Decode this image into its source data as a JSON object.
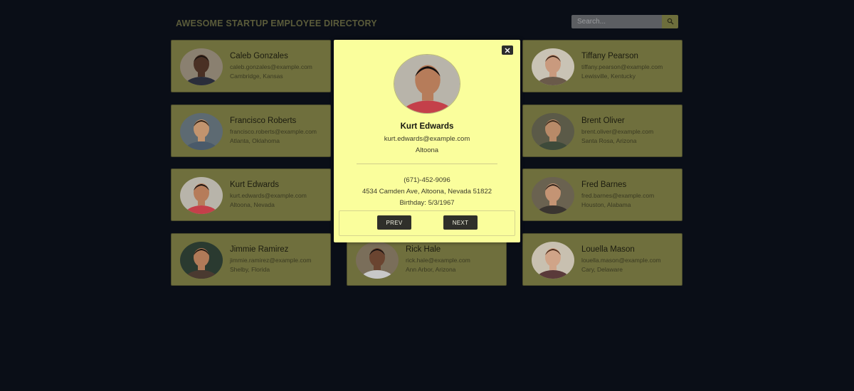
{
  "header": {
    "title": "AWESOME STARTUP EMPLOYEE DIRECTORY",
    "search_placeholder": "Search...",
    "search_icon": "search-icon"
  },
  "employees": [
    {
      "name": "Caleb Gonzales",
      "email": "caleb.gonzales@example.com",
      "location": "Cambridge, Kansas",
      "skin": "#4a3024",
      "hair": "#1a1410",
      "shirt": "#2a2d3a",
      "bg": "#8a8070"
    },
    {
      "name": "Tiffany Pearson",
      "email": "tiffany.pearson@example.com",
      "location": "Lewisville, Kentucky",
      "skin": "#c99a7e",
      "hair": "#3a2418",
      "shirt": "#6a5a4a",
      "bg": "#c9c3b5"
    },
    {
      "name": "Francisco Roberts",
      "email": "francisco.roberts@example.com",
      "location": "Atlanta, Oklahoma",
      "skin": "#c2946e",
      "hair": "#2b1e14",
      "shirt": "#4a5a6a",
      "bg": "#5d6a72"
    },
    {
      "name": "Brent Oliver",
      "email": "brent.oliver@example.com",
      "location": "Santa Rosa, Arizona",
      "skin": "#b88a68",
      "hair": "#3a2a1c",
      "shirt": "#3e4a3a",
      "bg": "#5b5a48"
    },
    {
      "name": "Kurt Edwards",
      "email": "kurt.edwards@example.com",
      "location": "Altoona, Nevada",
      "skin": "#b67c5a",
      "hair": "#141010",
      "shirt": "#c4404a",
      "bg": "#b8b4aa"
    },
    {
      "name": "Fred Barnes",
      "email": "fred.barnes@example.com",
      "location": "Houston, Alabama",
      "skin": "#c49474",
      "hair": "#2a2018",
      "shirt": "#3a3530",
      "bg": "#6a6250"
    },
    {
      "name": "Jimmie Ramirez",
      "email": "jimmie.ramirez@example.com",
      "location": "Shelby, Florida",
      "skin": "#b07a58",
      "hair": "#1a1410",
      "shirt": "#4a3a30",
      "bg": "#2a3a30"
    },
    {
      "name": "Rick Hale",
      "email": "rick.hale@example.com",
      "location": "Ann Arbor, Arizona",
      "skin": "#6a4430",
      "hair": "#141010",
      "shirt": "#c8c8c8",
      "bg": "#7a6e5a"
    },
    {
      "name": "Louella Mason",
      "email": "louella.mason@example.com",
      "location": "Cary, Delaware",
      "skin": "#d0a488",
      "hair": "#4a2a1a",
      "shirt": "#5a3a3a",
      "bg": "#c8c0b0"
    }
  ],
  "modal": {
    "name": "Kurt Edwards",
    "email": "kurt.edwards@example.com",
    "city": "Altoona",
    "phone": "(671)-452-9096",
    "address": "4534 Camden Ave, Altoona, Nevada 51822",
    "birthday": "Birthday: 5/3/1967",
    "close_icon": "close-icon",
    "prev_label": "PREV",
    "next_label": "NEXT"
  },
  "colors": {
    "background": "#0a0e17",
    "card": "#6f6f3d",
    "modal": "#fafe9c",
    "button": "#2f2f2a"
  }
}
